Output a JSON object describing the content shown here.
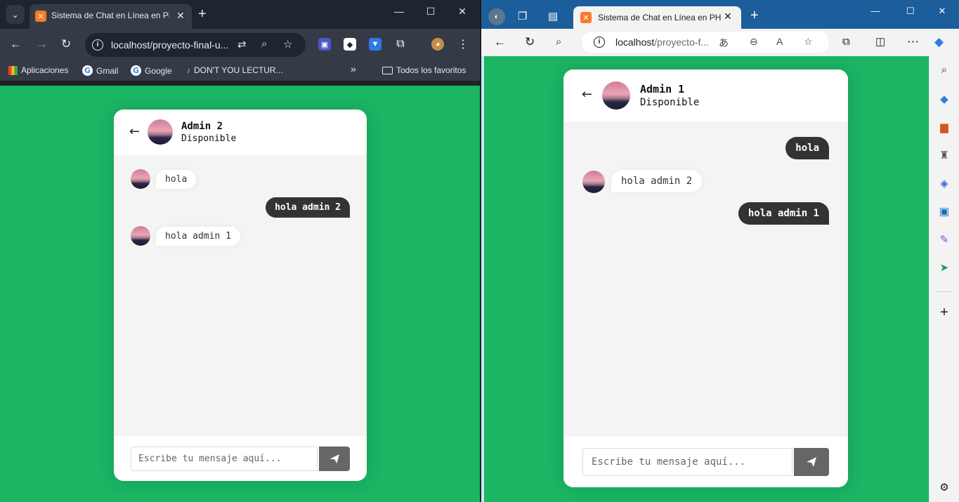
{
  "left_window": {
    "tab": {
      "title": "Sistema de Chat en Línea en PHP",
      "favicon": "xampp-icon"
    },
    "url": "localhost/proyecto-final-u...",
    "bookmarks": {
      "apps": "Aplicaciones",
      "gmail": "Gmail",
      "google": "Google",
      "lecture": "DON'T YOU LECTUR...",
      "more": "»",
      "all": "Todos los favoritos"
    },
    "chat": {
      "contact_name": "Admin 2",
      "contact_status": "Disponible",
      "messages": [
        {
          "direction": "incoming",
          "text": "hola"
        },
        {
          "direction": "outgoing",
          "text": "hola admin 2"
        },
        {
          "direction": "incoming",
          "text": "hola admin 1"
        }
      ],
      "input_placeholder": "Escribe tu mensaje aquí..."
    }
  },
  "right_window": {
    "tab": {
      "title": "Sistema de Chat en Línea en PHP",
      "favicon": "xampp-icon"
    },
    "url_host": "localhost",
    "url_rest": "/proyecto-f...",
    "chat": {
      "contact_name": "Admin 1",
      "contact_status": "Disponible",
      "messages": [
        {
          "direction": "outgoing",
          "text": "hola"
        },
        {
          "direction": "incoming",
          "text": "hola admin 2"
        },
        {
          "direction": "outgoing",
          "text": "hola admin 1"
        }
      ],
      "input_placeholder": "Escribe tu mensaje aquí..."
    }
  },
  "colors": {
    "page_background": "#1bb564",
    "outgoing_bubble": "#333333",
    "incoming_bubble": "#ffffff",
    "send_button": "#666666"
  }
}
